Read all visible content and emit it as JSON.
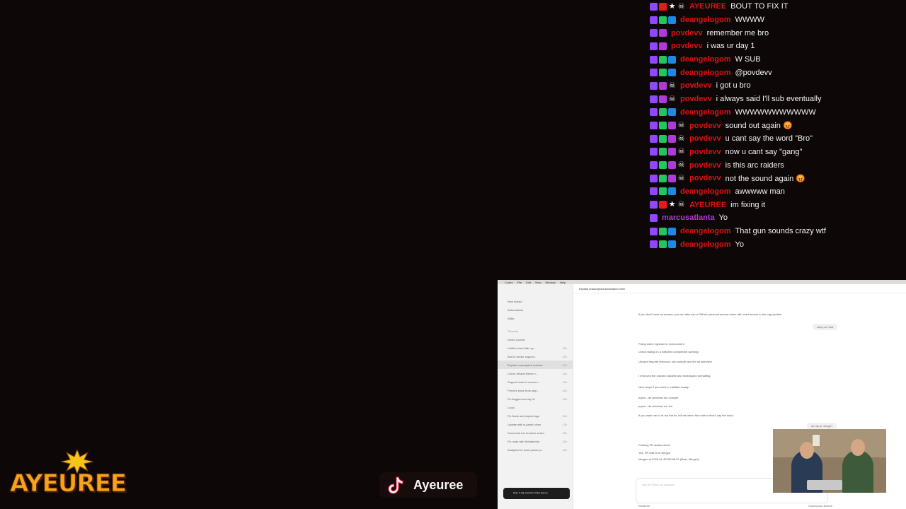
{
  "chat": {
    "messages": [
      {
        "user": "AYEUREE",
        "text": "BOUT TO FIX IT",
        "color": "#e01010",
        "badges": [
          "purple",
          "red",
          "star",
          "skull"
        ]
      },
      {
        "user": "deangelogom",
        "text": "WWWW",
        "color": "#e01010",
        "badges": [
          "purple",
          "green",
          "blue"
        ]
      },
      {
        "user": "povdevv",
        "text": "remember me bro",
        "color": "#e01010",
        "badges": [
          "purple",
          "pink"
        ]
      },
      {
        "user": "povdevv",
        "text": "i was ur day 1",
        "color": "#e01010",
        "badges": [
          "purple",
          "pink"
        ]
      },
      {
        "user": "deangelogom",
        "text": "W SUB",
        "color": "#e01010",
        "badges": [
          "purple",
          "green",
          "blue"
        ]
      },
      {
        "user": "deangelogom",
        "text": "@povdevv",
        "color": "#e01010",
        "badges": [
          "purple",
          "green",
          "blue"
        ]
      },
      {
        "user": "povdevv",
        "text": "i got u bro",
        "color": "#e01010",
        "badges": [
          "purple",
          "pink",
          "skull"
        ]
      },
      {
        "user": "povdevv",
        "text": "i always said I'll sub eventually",
        "color": "#e01010",
        "badges": [
          "purple",
          "pink",
          "skull"
        ]
      },
      {
        "user": "deangelogom",
        "text": "WWWWWWWWWWW",
        "color": "#e01010",
        "badges": [
          "purple",
          "green",
          "blue"
        ]
      },
      {
        "user": "povdevv",
        "text": "sound out again 😡",
        "color": "#e01010",
        "badges": [
          "purple",
          "green",
          "pink",
          "skull"
        ]
      },
      {
        "user": "povdevv",
        "text": "u cant say the word \"Bro\"",
        "color": "#e01010",
        "badges": [
          "purple",
          "green",
          "pink",
          "skull"
        ]
      },
      {
        "user": "povdevv",
        "text": "now u cant say \"gang\"",
        "color": "#e01010",
        "badges": [
          "purple",
          "green",
          "pink",
          "skull"
        ]
      },
      {
        "user": "povdevv",
        "text": "is this arc raiders",
        "color": "#e01010",
        "badges": [
          "purple",
          "green",
          "pink",
          "skull"
        ]
      },
      {
        "user": "povdevv",
        "text": "not the sound again 😡",
        "color": "#e01010",
        "badges": [
          "purple",
          "green",
          "pink",
          "skull"
        ]
      },
      {
        "user": "deangelogom",
        "text": "awwwww man",
        "color": "#e01010",
        "badges": [
          "purple",
          "green",
          "blue"
        ]
      },
      {
        "user": "AYEUREE",
        "text": "im fixing it",
        "color": "#e01010",
        "badges": [
          "purple",
          "red",
          "star",
          "skull"
        ]
      },
      {
        "user": "marcusatlanta",
        "text": "Yo",
        "color": "#b03ad8",
        "badges": [
          "purple"
        ]
      },
      {
        "user": "deangelogom",
        "text": "That gun sounds crazy wtf",
        "color": "#e01010",
        "badges": [
          "purple",
          "green",
          "blue"
        ]
      },
      {
        "user": "deangelogom",
        "text": "Yo",
        "color": "#e01010",
        "badges": [
          "purple",
          "green",
          "blue"
        ]
      }
    ]
  },
  "logo": {
    "text": "AYEUREE",
    "color": "#f7a21a"
  },
  "tiktok": {
    "handle": "Ayeuree",
    "icon": "tiktok-icon"
  },
  "screen": {
    "menubar": [
      "Codex",
      "File",
      "Edit",
      "View",
      "Window",
      "Help"
    ],
    "left_pane": {
      "nav": [
        "New thread",
        "Automations",
        "Skills"
      ],
      "section": "Threads",
      "items": [
        {
          "label": "codex-vscode",
          "sub": ""
        },
        {
          "label": "Untitled view filter op...",
          "meta": "12h"
        },
        {
          "label": "Add in-vector support...",
          "meta": "12h"
        },
        {
          "label": "Explain unaccepted automa...",
          "meta": "12h",
          "selected": true
        },
        {
          "label": "Check default theme v...",
          "meta": "12h"
        },
        {
          "label": "Support main in monoro...",
          "meta": "12h"
        },
        {
          "label": "Prevent trace from stop...",
          "meta": "12h"
        },
        {
          "label": "Fix flagged-overlay itl...",
          "meta": "12h"
        },
        {
          "label": "Local",
          "meta": ""
        },
        {
          "label": "Fix Node and impact logs",
          "meta": "12h"
        },
        {
          "label": "Update with w-panel token",
          "meta": "12h"
        },
        {
          "label": "Document the browser-sessi...",
          "meta": "12h"
        },
        {
          "label": "Fix node with fullcalendar",
          "meta": "12h"
        },
        {
          "label": "Analytics for track points pr...",
          "meta": "12h"
        }
      ],
      "signup": "Keep in-app sessions Codex sign up"
    },
    "main": {
      "title": "Explain unaccepted automation view",
      "lines": [
        "If you don't have an access, you can also use a GitHub personal access token with read access to the org pipeline.",
        "Fixing token injection in environment",
        "Check failing on a webview compile/lint warning:",
        "Unused imports removed; ran compile and lint on webview",
        "I removed the unused variable and redeployed formatting.",
        "Next steps if you want to validate locally:",
        "pnpm --dir webview run compile",
        "pnpm --dir webview run lint",
        "If you want me to re-run the fix, tell me when the code is fixed, say the word.",
        "Pushing PR status check",
        "Yes. PR 64872 is merged",
        "Merged at 2026-01-30T05:58:32 (Main: Merged)"
      ],
      "pill_okay": "okay run that",
      "pill_merged": "do my pr merge?",
      "composer": "Ask for follow-up changes",
      "footer_left": "Worktree",
      "footer_right": "Codex/your-branch"
    }
  }
}
